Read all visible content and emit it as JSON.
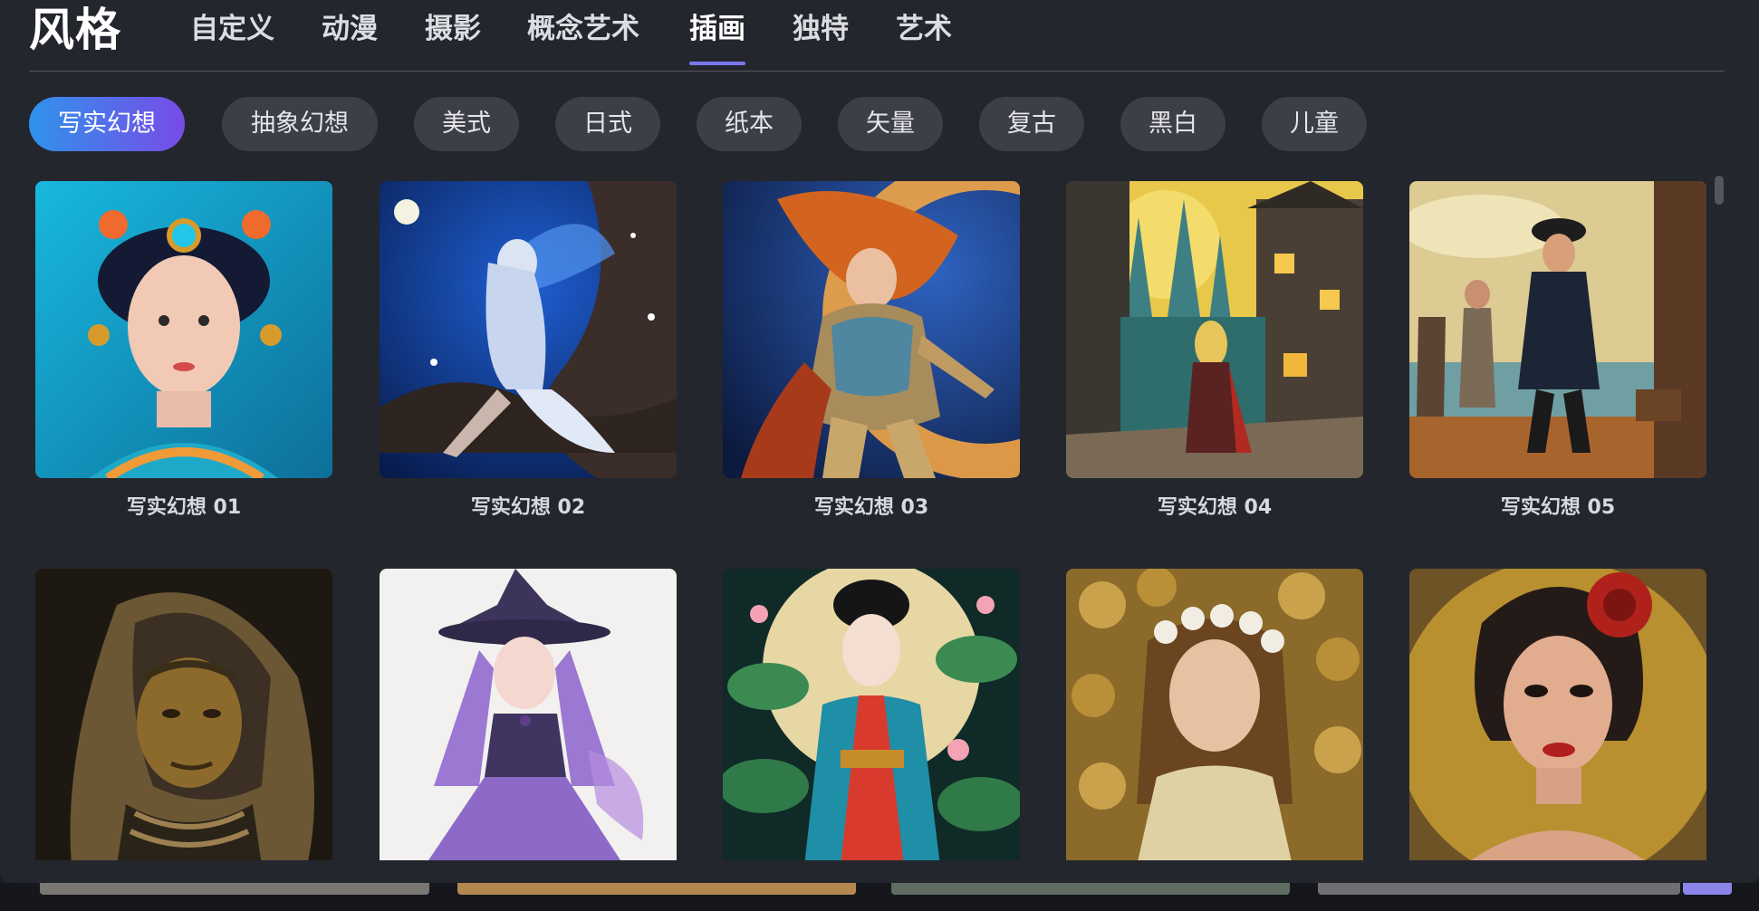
{
  "header": {
    "title": "风格",
    "tabs": [
      {
        "label": "自定义",
        "active": false
      },
      {
        "label": "动漫",
        "active": false
      },
      {
        "label": "摄影",
        "active": false
      },
      {
        "label": "概念艺术",
        "active": false
      },
      {
        "label": "插画",
        "active": true
      },
      {
        "label": "独特",
        "active": false
      },
      {
        "label": "艺术",
        "active": false
      }
    ]
  },
  "filters": {
    "chips": [
      {
        "label": "写实幻想",
        "active": true
      },
      {
        "label": "抽象幻想",
        "active": false
      },
      {
        "label": "美式",
        "active": false
      },
      {
        "label": "日式",
        "active": false
      },
      {
        "label": "纸本",
        "active": false
      },
      {
        "label": "矢量",
        "active": false
      },
      {
        "label": "复古",
        "active": false
      },
      {
        "label": "黑白",
        "active": false
      },
      {
        "label": "儿童",
        "active": false
      }
    ]
  },
  "gallery": {
    "items": [
      {
        "label": "写实幻想 01",
        "icon": "portrait-jeweled-woman-image"
      },
      {
        "label": "写实幻想 02",
        "icon": "fairy-night-tree-image"
      },
      {
        "label": "写实幻想 03",
        "icon": "warrior-red-hair-image"
      },
      {
        "label": "写实幻想 04",
        "icon": "fantasy-town-image"
      },
      {
        "label": "写实幻想 05",
        "icon": "pirates-ship-image"
      },
      {
        "label": "",
        "icon": "hooded-figure-image"
      },
      {
        "label": "",
        "icon": "purple-witch-image"
      },
      {
        "label": "",
        "icon": "moon-lotus-lady-image"
      },
      {
        "label": "",
        "icon": "flower-crown-girl-image"
      },
      {
        "label": "",
        "icon": "rose-hair-woman-image"
      }
    ]
  },
  "colors": {
    "background": "#24262d",
    "accent": "#7876ed",
    "chip_gradient_start": "#2f93eb",
    "chip_gradient_end": "#784be7"
  }
}
